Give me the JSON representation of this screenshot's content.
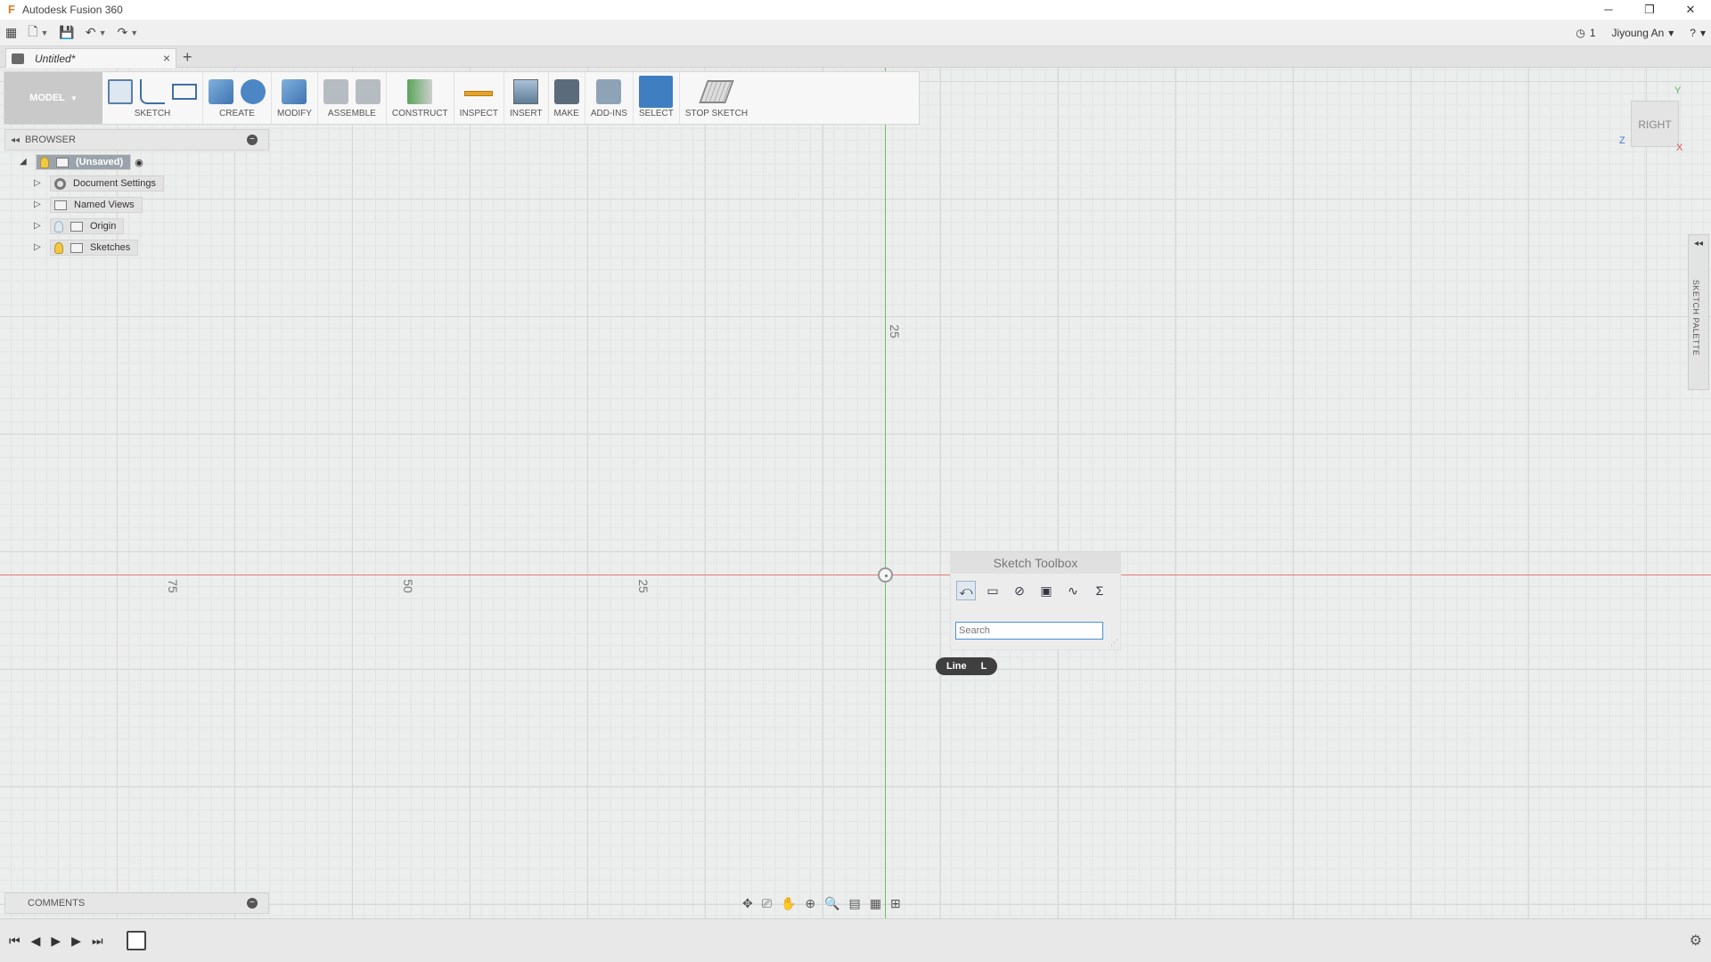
{
  "window": {
    "title": "Autodesk Fusion 360",
    "controls": [
      "─",
      "❐",
      "✕"
    ]
  },
  "qat": {
    "job_status": "1",
    "user": "Jiyoung An",
    "help": "?"
  },
  "tab": {
    "doc_name": "Untitled*",
    "close": "×",
    "new": "+"
  },
  "ribbon": {
    "workspace": "MODEL",
    "groups": [
      "SKETCH",
      "CREATE",
      "MODIFY",
      "ASSEMBLE",
      "CONSTRUCT",
      "INSPECT",
      "INSERT",
      "MAKE",
      "ADD-INS",
      "SELECT"
    ],
    "stop_sketch": "STOP SKETCH"
  },
  "browser": {
    "title": "BROWSER",
    "root": "(Unsaved)",
    "items": [
      "Document Settings",
      "Named Views",
      "Origin",
      "Sketches"
    ]
  },
  "comments": {
    "title": "COMMENTS"
  },
  "viewcube": {
    "face": "RIGHT",
    "axis_y": "Y",
    "axis_z": "Z",
    "axis_x": "X"
  },
  "sketch_palette": {
    "label": "SKETCH PALETTE"
  },
  "toolbox": {
    "title": "Sketch Toolbox",
    "search_placeholder": "Search"
  },
  "tooltip": {
    "name": "Line",
    "shortcut": "L"
  },
  "grid_ticks": {
    "x": [
      "75",
      "50",
      "25"
    ],
    "y": [
      "25"
    ]
  }
}
